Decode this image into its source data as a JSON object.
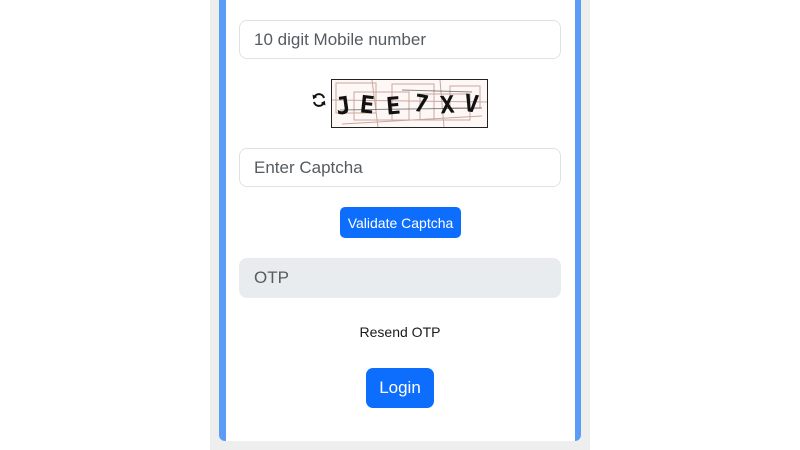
{
  "form": {
    "mobile_placeholder": "10 digit Mobile number",
    "captcha_placeholder": "Enter Captcha",
    "otp_placeholder": "OTP",
    "validate_label": "Validate Captcha",
    "resend_label": "Resend OTP",
    "login_label": "Login"
  },
  "captcha": {
    "text": "JEE7XV",
    "chars": [
      "J",
      "E",
      "E",
      "7",
      "X",
      "V"
    ]
  },
  "icons": {
    "refresh": "refresh-icon"
  },
  "colors": {
    "primary": "#0d6efd",
    "card_border": "#5b9cf6",
    "otp_bg": "#e9ecef"
  }
}
